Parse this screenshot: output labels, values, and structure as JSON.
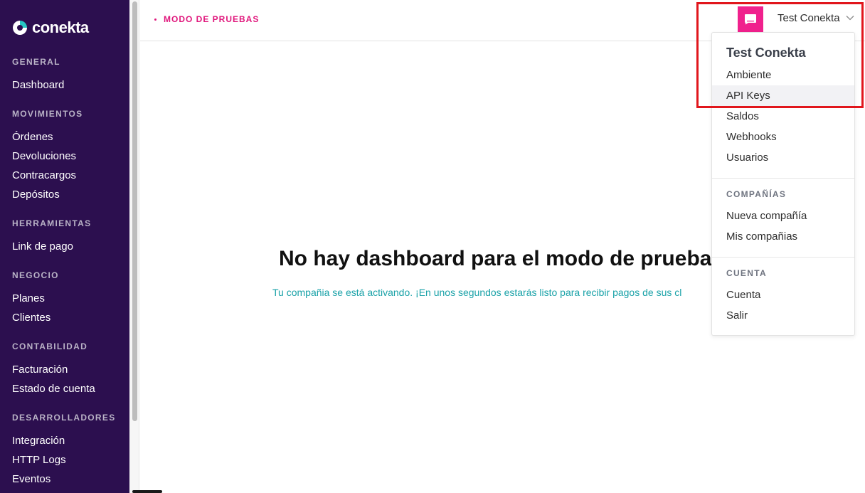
{
  "brand": {
    "name": "conekta"
  },
  "sidebar": {
    "sections": [
      {
        "heading": "GENERAL",
        "items": [
          "Dashboard"
        ]
      },
      {
        "heading": "MOVIMIENTOS",
        "items": [
          "Órdenes",
          "Devoluciones",
          "Contracargos",
          "Depósitos"
        ]
      },
      {
        "heading": "HERRAMIENTAS",
        "items": [
          "Link de pago"
        ]
      },
      {
        "heading": "NEGOCIO",
        "items": [
          "Planes",
          "Clientes"
        ]
      },
      {
        "heading": "CONTABILIDAD",
        "items": [
          "Facturación",
          "Estado de cuenta"
        ]
      },
      {
        "heading": "DESARROLLADORES",
        "items": [
          "Integración",
          "HTTP Logs",
          "Eventos"
        ]
      }
    ]
  },
  "header": {
    "mode_label": "MODO DE PRUEBAS",
    "account_name": "Test Conekta",
    "avatar_icon": "chat-bubble-icon",
    "chevron_icon": "chevron-down-icon"
  },
  "main": {
    "title": "No hay dashboard para el modo de prueba",
    "subtitle": "Tu compañia se está activando. ¡En unos segundos estarás listo para recibir pagos de sus cl"
  },
  "dropdown": {
    "title": "Test Conekta",
    "items": [
      "Ambiente",
      "API Keys",
      "Saldos",
      "Webhooks",
      "Usuarios"
    ],
    "active_item": "API Keys",
    "companies_heading": "COMPAÑÍAS",
    "companies_items": [
      "Nueva compañía",
      "Mis compañias"
    ],
    "account_heading": "CUENTA",
    "account_items": [
      "Cuenta",
      "Salir"
    ]
  },
  "colors": {
    "sidebar_bg": "#2c0f4f",
    "accent_pink": "#e0177c",
    "avatar_pink": "#f0218d",
    "teal_text": "#1aa2a8",
    "highlight_red": "#e1161c"
  }
}
